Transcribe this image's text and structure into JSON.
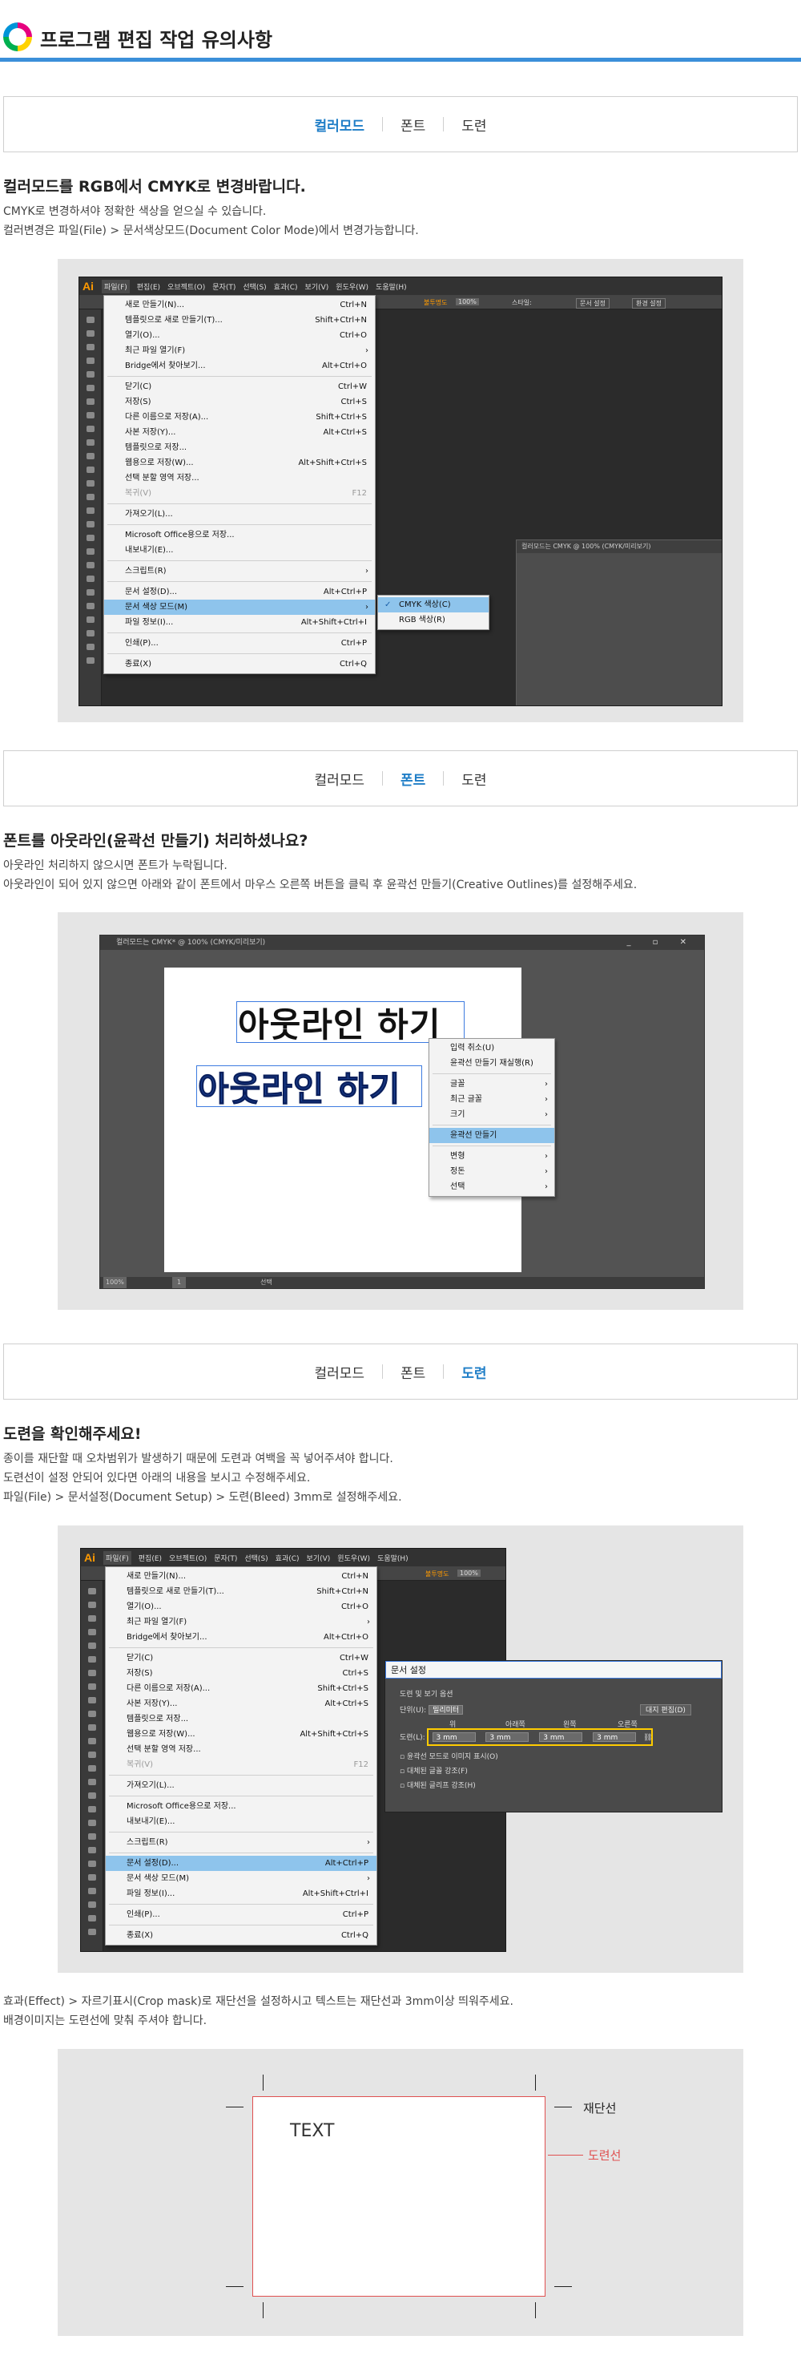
{
  "header": {
    "title": "프로그램 편집 작업 유의사항"
  },
  "tabs": {
    "color": "컬러모드",
    "font": "폰트",
    "bleed": "도련"
  },
  "section_color": {
    "heading": "컬러모드를 RGB에서 CMYK로 변경바랍니다.",
    "line1": "CMYK로 변경하셔야 정확한 색상을 얻으실 수 있습니다.",
    "line2": "컬러변경은 파일(File) > 문서색상모드(Document Color Mode)에서 변경가능합니다."
  },
  "section_font": {
    "heading": "폰트를 아웃라인(윤곽선 만들기) 처리하셨나요?",
    "line1": "아웃라인 처리하지 않으시면 폰트가 누락됩니다.",
    "line2": "아웃라인이 되어 있지 않으면 아래와 같이 폰트에서 마우스 오른쪽 버튼을 클릭 후 윤곽선 만들기(Creative Outlines)를 설정해주세요."
  },
  "section_bleed": {
    "heading": "도련을 확인해주세요!",
    "line1": "종이를 재단할 때 오차범위가 발생하기 때문에 도련과 여백을 꼭 넣어주셔야 합니다.",
    "line2": "도련선이 설정 안되어 있다면 아래의 내용을 보시고 수정해주세요.",
    "line3": "파일(File) > 문서설정(Document Setup) > 도련(Bleed) 3mm로 설정해주세요.",
    "note1": "효과(Effect) > 자르기표시(Crop mask)로 재단선을 설정하시고 텍스트는 재단선과 3mm이상 띄워주세요.",
    "note2": "배경이미지는 도련선에 맞춰 주셔야 합니다."
  },
  "ai_menubar": [
    "파일(F)",
    "편집(E)",
    "오브젝트(O)",
    "문자(T)",
    "선택(S)",
    "효과(C)",
    "보기(V)",
    "윈도우(W)",
    "도움말(H)"
  ],
  "ai_toolbar": {
    "fill_label": "불투명도",
    "fill_value": "100%",
    "style_label": "스타일:",
    "doc_setup": "문서 설정",
    "prefs": "환경 설정"
  },
  "file_menu": [
    {
      "label": "새로 만들기(N)...",
      "shortcut": "Ctrl+N"
    },
    {
      "label": "템플릿으로 새로 만들기(T)...",
      "shortcut": "Shift+Ctrl+N"
    },
    {
      "label": "열기(O)...",
      "shortcut": "Ctrl+O"
    },
    {
      "label": "최근 파일 열기(F)",
      "shortcut": "",
      "submenu": true
    },
    {
      "label": "Bridge에서 찾아보기...",
      "shortcut": "Alt+Ctrl+O"
    },
    {
      "sep": true
    },
    {
      "label": "닫기(C)",
      "shortcut": "Ctrl+W"
    },
    {
      "label": "저장(S)",
      "shortcut": "Ctrl+S"
    },
    {
      "label": "다른 이름으로 저장(A)...",
      "shortcut": "Shift+Ctrl+S"
    },
    {
      "label": "사본 저장(Y)...",
      "shortcut": "Alt+Ctrl+S"
    },
    {
      "label": "템플릿으로 저장...",
      "shortcut": ""
    },
    {
      "label": "웹용으로 저장(W)...",
      "shortcut": "Alt+Shift+Ctrl+S"
    },
    {
      "label": "선택 분할 영역 저장...",
      "shortcut": ""
    },
    {
      "label": "복귀(V)",
      "shortcut": "F12",
      "disabled": true
    },
    {
      "sep": true
    },
    {
      "label": "가져오기(L)...",
      "shortcut": ""
    },
    {
      "sep": true
    },
    {
      "label": "Microsoft Office용으로 저장...",
      "shortcut": ""
    },
    {
      "label": "내보내기(E)...",
      "shortcut": ""
    },
    {
      "sep": true
    },
    {
      "label": "스크립트(R)",
      "shortcut": "",
      "submenu": true
    },
    {
      "sep": true
    },
    {
      "label": "문서 설정(D)...",
      "shortcut": "Alt+Ctrl+P"
    },
    {
      "label": "문서 색상 모드(M)",
      "shortcut": "",
      "submenu": true
    },
    {
      "label": "파일 정보(I)...",
      "shortcut": "Alt+Shift+Ctrl+I"
    },
    {
      "sep": true
    },
    {
      "label": "인쇄(P)...",
      "shortcut": "Ctrl+P"
    },
    {
      "sep": true
    },
    {
      "label": "종료(X)",
      "shortcut": "Ctrl+Q"
    }
  ],
  "color_submenu": {
    "cmyk": "CMYK 색상(C)",
    "rgb": "RGB 색상(R)"
  },
  "doc_window_title": "컬러모드는 CMYK @ 100% (CMYK/미리보기)",
  "font_mock": {
    "win_title": "컬러모드는 CMYK* @ 100% (CMYK/미리보기)",
    "text_plain": "아웃라인 하기",
    "text_outlined": "아웃라인 하기",
    "zoom": "100%",
    "page": "1",
    "status": "선택",
    "context_menu": [
      {
        "label": "입력 취소(U)"
      },
      {
        "label": "윤곽선 만들기 재실행(R)"
      },
      {
        "sep": true
      },
      {
        "label": "글꼴",
        "submenu": true
      },
      {
        "label": "최근 글꼴",
        "submenu": true
      },
      {
        "label": "크기",
        "submenu": true
      },
      {
        "sep": true
      },
      {
        "label": "윤곽선 만들기",
        "highlight": true
      },
      {
        "sep": true
      },
      {
        "label": "변형",
        "submenu": true
      },
      {
        "label": "정돈",
        "submenu": true
      },
      {
        "label": "선택",
        "submenu": true
      }
    ]
  },
  "doc_setup": {
    "title": "문서 설정",
    "group": "도련 및 보기 옵션",
    "unit_label": "단위(U):",
    "unit_value": "밀리미터",
    "edit_artboard": "대지 편집(D)",
    "col_top": "위",
    "col_bottom": "아래쪽",
    "col_left": "왼쪽",
    "col_right": "오른쪽",
    "bleed_label": "도련(L):",
    "bleed_top": "3 mm",
    "bleed_bottom": "3 mm",
    "bleed_left": "3 mm",
    "bleed_right": "3 mm",
    "opt1": "윤곽선 모드로 이미지 표시(O)",
    "opt2": "대체된 글꼴 강조(F)",
    "opt3": "대체된 글리프 강조(H)"
  },
  "crop_diagram": {
    "text": "TEXT",
    "trim_label": "재단선",
    "bleed_label": "도련선"
  },
  "colors": {
    "accent": "#1f7ec7",
    "header_rule": "#3b8fd9",
    "bleed_line": "#e05050"
  }
}
